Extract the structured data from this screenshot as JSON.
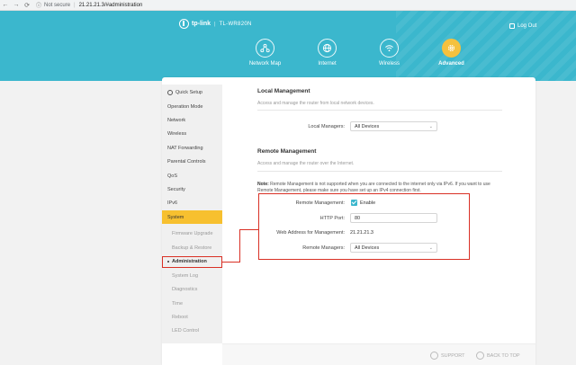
{
  "browser": {
    "back": "←",
    "forward": "→",
    "reload": "⟳",
    "not_secure": "Not secure",
    "separator": "|",
    "url": "21.21.21.3/#administration"
  },
  "header": {
    "brand": "tp-link",
    "brand_separator": "|",
    "model": "TL-WR820N",
    "logout": "Log Out",
    "tabs": [
      {
        "label": "Network Map",
        "icon": "network-map-icon"
      },
      {
        "label": "Internet",
        "icon": "globe-icon"
      },
      {
        "label": "Wireless",
        "icon": "wifi-icon"
      },
      {
        "label": "Advanced",
        "icon": "gear-icon",
        "active": true
      }
    ]
  },
  "sidebar": {
    "items": [
      {
        "label": "Quick Setup"
      },
      {
        "label": "Operation Mode"
      },
      {
        "label": "Network"
      },
      {
        "label": "Wireless"
      },
      {
        "label": "NAT Forwarding"
      },
      {
        "label": "Parental Controls"
      },
      {
        "label": "QoS"
      },
      {
        "label": "Security"
      },
      {
        "label": "IPv6"
      },
      {
        "label": "System",
        "selected": true
      },
      {
        "label": "Firmware Upgrade",
        "sub": true
      },
      {
        "label": "Backup & Restore",
        "sub": true
      },
      {
        "label": "Administration",
        "sub": true,
        "current": true
      },
      {
        "label": "System Log",
        "sub": true
      },
      {
        "label": "Diagnostics",
        "sub": true
      },
      {
        "label": "Time",
        "sub": true
      },
      {
        "label": "Reboot",
        "sub": true
      },
      {
        "label": "LED Control",
        "sub": true
      }
    ]
  },
  "local": {
    "title": "Local Management",
    "desc": "Access and manage the router from local network devices.",
    "managers_label": "Local Managers:",
    "managers_value": "All Devices"
  },
  "remote": {
    "title": "Remote Management",
    "desc": "Access and manage the router over the Internet.",
    "note_bold": "Note:",
    "note_text": " Remote Management is not supported when you are connected to the internet only via IPv6. If you want to use Remote Management, please make sure you have set up an IPv4 connection first.",
    "enable_label": "Remote Management:",
    "enable_checkbox": "Enable",
    "port_label": "HTTP Port:",
    "port_value": "80",
    "address_label": "Web Address for Management:",
    "address_value": "21.21.21.3",
    "managers_label": "Remote Managers:",
    "managers_value": "All Devices"
  },
  "footer": {
    "support": "SUPPORT",
    "back_to_top": "BACK TO TOP"
  },
  "colors": {
    "header": "#3bb7cd",
    "accent": "#f7c02f",
    "highlight": "#d93025"
  }
}
